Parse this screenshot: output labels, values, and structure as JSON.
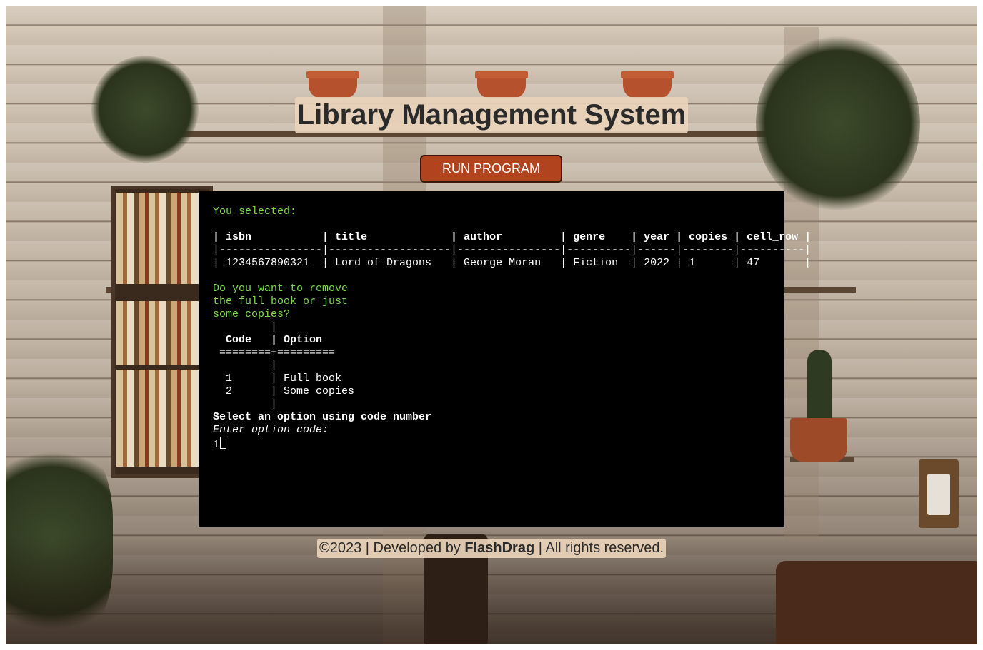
{
  "header": {
    "title": "Library Management System"
  },
  "toolbar": {
    "run_label": "RUN PROGRAM"
  },
  "terminal": {
    "selected_label": "You selected:",
    "table": {
      "header_line": "| isbn           | title             | author         | genre    | year | copies | cell_row |",
      "separator_line": "|----------------|-------------------|----------------|----------|------|--------|----------|",
      "row_line": "| 1234567890321  | Lord of Dragons   | George Moran   | Fiction  | 2022 | 1      | 47       |"
    },
    "question_lines": [
      "Do you want to remove",
      "the full book or just",
      "some copies?"
    ],
    "options_table": {
      "top_line": "         |",
      "header_line": "  Code   | Option",
      "rule_line": " ========+=========",
      "blank_line": "         |",
      "rows": [
        "  1      | Full book",
        "  2      | Some copies"
      ],
      "bottom_line": "         |"
    },
    "prompt_heading": "Select an option using code number",
    "prompt_input": "Enter option code:",
    "input_value": "1"
  },
  "footer": {
    "prefix": "©2023 | Developed by ",
    "brand": "FlashDrag",
    "suffix": " | All rights reserved."
  },
  "colors": {
    "accent": "#b2431f",
    "terminal_bg": "#000000",
    "terminal_green": "#7cd84a",
    "label_bg": "#e9d3ba"
  }
}
